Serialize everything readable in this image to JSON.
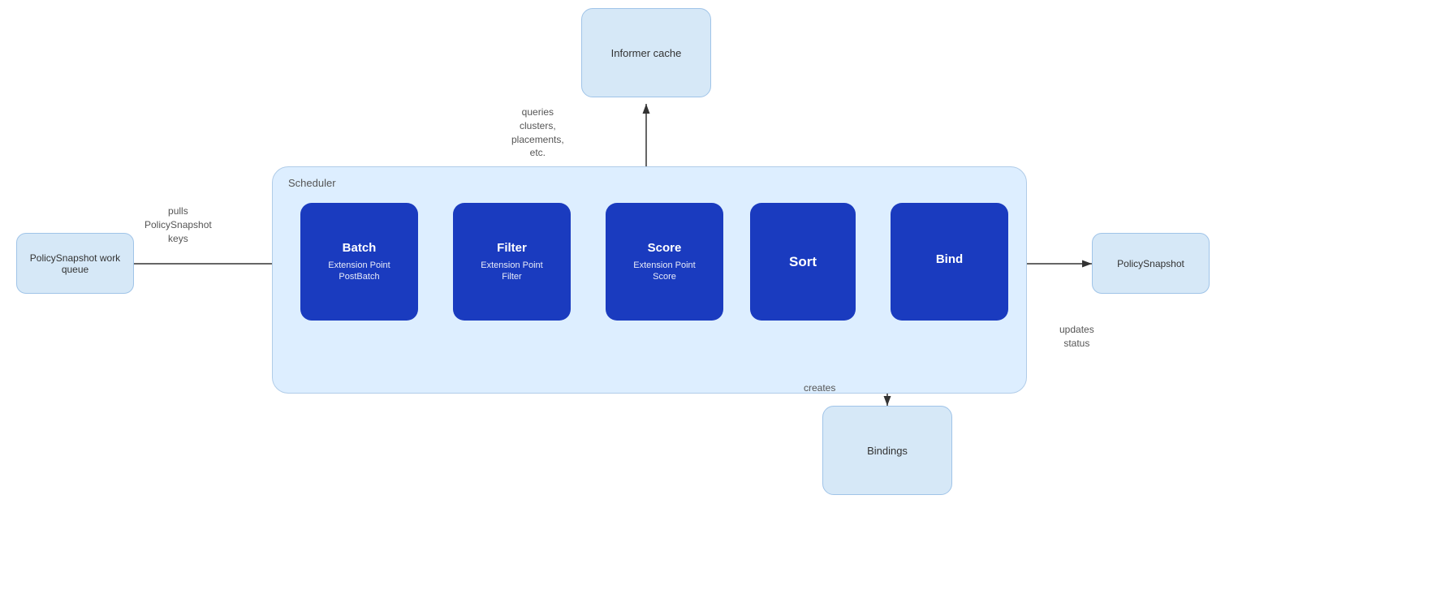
{
  "informer_cache": {
    "label": "Informer cache"
  },
  "scheduler": {
    "label": "Scheduler"
  },
  "pipeline": {
    "batch": {
      "title": "Batch",
      "subtitle_line1": "Extension Point",
      "subtitle_line2": "PostBatch"
    },
    "filter": {
      "title": "Filter",
      "subtitle_line1": "Extension Point",
      "subtitle_line2": "Filter"
    },
    "score": {
      "title": "Score",
      "subtitle_line1": "Extension Point",
      "subtitle_line2": "Score"
    },
    "sort": {
      "title": "Sort"
    },
    "bind": {
      "title": "Bind"
    }
  },
  "work_queue": {
    "label": "PolicySnapshot work queue"
  },
  "policy_snapshot_out": {
    "label": "PolicySnapshot"
  },
  "bindings": {
    "label": "Bindings"
  },
  "arrow_labels": {
    "pulls": "pulls\nPolicySnapshot\nkeys",
    "queries": "queries\nclusters,\nplacements,\netc.",
    "creates": "creates",
    "updates": "updates\nstatus"
  }
}
